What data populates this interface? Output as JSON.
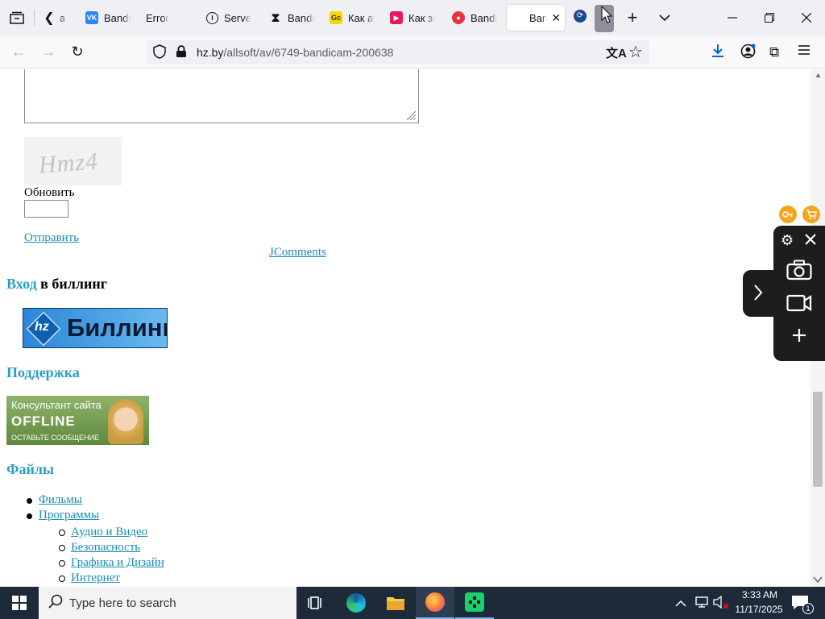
{
  "browser": {
    "tabs": [
      {
        "title": "a",
        "favicon": "generic-page-icon",
        "color": "#888888"
      },
      {
        "title": "Bandic",
        "favicon": "vk-icon",
        "color": "#2787f5"
      },
      {
        "title": "Error",
        "favicon": "none",
        "color": ""
      },
      {
        "title": "Server",
        "favicon": "info-icon",
        "color": "#15141a"
      },
      {
        "title": "Bandic",
        "favicon": "hourglass-icon",
        "color": "#15141a"
      },
      {
        "title": "Как ау",
        "favicon": "yellow-site-icon",
        "color": "#f5d800"
      },
      {
        "title": "Как за",
        "favicon": "video-camera-icon",
        "color": "#e8195a"
      },
      {
        "title": "Bandic",
        "favicon": "bandicam-icon",
        "color": "#e8313c"
      },
      {
        "title": "Ban",
        "favicon": "none",
        "color": ""
      }
    ],
    "active_tab_close": "×",
    "new_tab": "+",
    "url_domain": "hz.by",
    "url_path": "/allsoft/av/6749-bandicam-200638"
  },
  "page": {
    "captcha_text": "Hmz4",
    "refresh_label": "Обновить",
    "submit_label": "Отправить",
    "jcomments_label": "JComments",
    "billing_heading_link": "Вход",
    "billing_heading_rest": " в биллинг",
    "billing_banner_text": "Биллинг",
    "billing_banner_logo": "hz",
    "support_heading": "Поддержка",
    "support_banner": {
      "line1": "Консультант сайта",
      "line2": "OFFLINE",
      "line3": "ОСТАВЬТЕ СООБЩЕНИЕ"
    },
    "files_heading": "Файлы",
    "files_items": [
      "Фильмы",
      "Программы"
    ],
    "programs_sub": [
      "Аудио и Видео",
      "Безопасность",
      "Графика и Дизайн",
      "Интернет"
    ]
  },
  "taskbar": {
    "search_placeholder": "Type here to search",
    "time": "3:33 AM",
    "date": "11/17/2025",
    "notification_count": "1"
  },
  "colors": {
    "link": "#1a8bb5",
    "heading": "#2a9fc4",
    "taskbar": "#1c2a3a"
  }
}
